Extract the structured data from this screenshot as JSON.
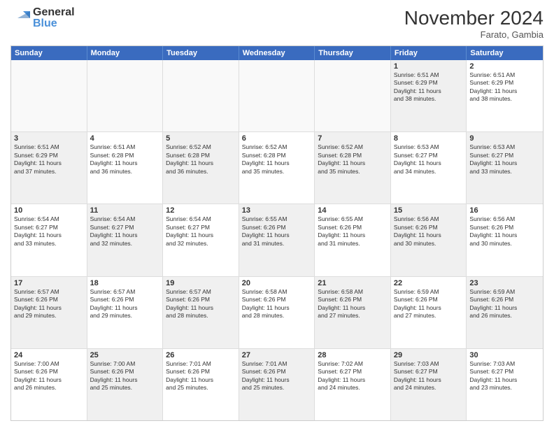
{
  "logo": {
    "general": "General",
    "blue": "Blue"
  },
  "title": "November 2024",
  "location": "Farato, Gambia",
  "days": [
    "Sunday",
    "Monday",
    "Tuesday",
    "Wednesday",
    "Thursday",
    "Friday",
    "Saturday"
  ],
  "rows": [
    [
      {
        "day": "",
        "text": "",
        "empty": true
      },
      {
        "day": "",
        "text": "",
        "empty": true
      },
      {
        "day": "",
        "text": "",
        "empty": true
      },
      {
        "day": "",
        "text": "",
        "empty": true
      },
      {
        "day": "",
        "text": "",
        "empty": true
      },
      {
        "day": "1",
        "text": "Sunrise: 6:51 AM\nSunset: 6:29 PM\nDaylight: 11 hours\nand 38 minutes.",
        "shaded": true
      },
      {
        "day": "2",
        "text": "Sunrise: 6:51 AM\nSunset: 6:29 PM\nDaylight: 11 hours\nand 38 minutes.",
        "shaded": false
      }
    ],
    [
      {
        "day": "3",
        "text": "Sunrise: 6:51 AM\nSunset: 6:29 PM\nDaylight: 11 hours\nand 37 minutes.",
        "shaded": true
      },
      {
        "day": "4",
        "text": "Sunrise: 6:51 AM\nSunset: 6:28 PM\nDaylight: 11 hours\nand 36 minutes.",
        "shaded": false
      },
      {
        "day": "5",
        "text": "Sunrise: 6:52 AM\nSunset: 6:28 PM\nDaylight: 11 hours\nand 36 minutes.",
        "shaded": true
      },
      {
        "day": "6",
        "text": "Sunrise: 6:52 AM\nSunset: 6:28 PM\nDaylight: 11 hours\nand 35 minutes.",
        "shaded": false
      },
      {
        "day": "7",
        "text": "Sunrise: 6:52 AM\nSunset: 6:28 PM\nDaylight: 11 hours\nand 35 minutes.",
        "shaded": true
      },
      {
        "day": "8",
        "text": "Sunrise: 6:53 AM\nSunset: 6:27 PM\nDaylight: 11 hours\nand 34 minutes.",
        "shaded": false
      },
      {
        "day": "9",
        "text": "Sunrise: 6:53 AM\nSunset: 6:27 PM\nDaylight: 11 hours\nand 33 minutes.",
        "shaded": true
      }
    ],
    [
      {
        "day": "10",
        "text": "Sunrise: 6:54 AM\nSunset: 6:27 PM\nDaylight: 11 hours\nand 33 minutes.",
        "shaded": false
      },
      {
        "day": "11",
        "text": "Sunrise: 6:54 AM\nSunset: 6:27 PM\nDaylight: 11 hours\nand 32 minutes.",
        "shaded": true
      },
      {
        "day": "12",
        "text": "Sunrise: 6:54 AM\nSunset: 6:27 PM\nDaylight: 11 hours\nand 32 minutes.",
        "shaded": false
      },
      {
        "day": "13",
        "text": "Sunrise: 6:55 AM\nSunset: 6:26 PM\nDaylight: 11 hours\nand 31 minutes.",
        "shaded": true
      },
      {
        "day": "14",
        "text": "Sunrise: 6:55 AM\nSunset: 6:26 PM\nDaylight: 11 hours\nand 31 minutes.",
        "shaded": false
      },
      {
        "day": "15",
        "text": "Sunrise: 6:56 AM\nSunset: 6:26 PM\nDaylight: 11 hours\nand 30 minutes.",
        "shaded": true
      },
      {
        "day": "16",
        "text": "Sunrise: 6:56 AM\nSunset: 6:26 PM\nDaylight: 11 hours\nand 30 minutes.",
        "shaded": false
      }
    ],
    [
      {
        "day": "17",
        "text": "Sunrise: 6:57 AM\nSunset: 6:26 PM\nDaylight: 11 hours\nand 29 minutes.",
        "shaded": true
      },
      {
        "day": "18",
        "text": "Sunrise: 6:57 AM\nSunset: 6:26 PM\nDaylight: 11 hours\nand 29 minutes.",
        "shaded": false
      },
      {
        "day": "19",
        "text": "Sunrise: 6:57 AM\nSunset: 6:26 PM\nDaylight: 11 hours\nand 28 minutes.",
        "shaded": true
      },
      {
        "day": "20",
        "text": "Sunrise: 6:58 AM\nSunset: 6:26 PM\nDaylight: 11 hours\nand 28 minutes.",
        "shaded": false
      },
      {
        "day": "21",
        "text": "Sunrise: 6:58 AM\nSunset: 6:26 PM\nDaylight: 11 hours\nand 27 minutes.",
        "shaded": true
      },
      {
        "day": "22",
        "text": "Sunrise: 6:59 AM\nSunset: 6:26 PM\nDaylight: 11 hours\nand 27 minutes.",
        "shaded": false
      },
      {
        "day": "23",
        "text": "Sunrise: 6:59 AM\nSunset: 6:26 PM\nDaylight: 11 hours\nand 26 minutes.",
        "shaded": true
      }
    ],
    [
      {
        "day": "24",
        "text": "Sunrise: 7:00 AM\nSunset: 6:26 PM\nDaylight: 11 hours\nand 26 minutes.",
        "shaded": false
      },
      {
        "day": "25",
        "text": "Sunrise: 7:00 AM\nSunset: 6:26 PM\nDaylight: 11 hours\nand 25 minutes.",
        "shaded": true
      },
      {
        "day": "26",
        "text": "Sunrise: 7:01 AM\nSunset: 6:26 PM\nDaylight: 11 hours\nand 25 minutes.",
        "shaded": false
      },
      {
        "day": "27",
        "text": "Sunrise: 7:01 AM\nSunset: 6:26 PM\nDaylight: 11 hours\nand 25 minutes.",
        "shaded": true
      },
      {
        "day": "28",
        "text": "Sunrise: 7:02 AM\nSunset: 6:27 PM\nDaylight: 11 hours\nand 24 minutes.",
        "shaded": false
      },
      {
        "day": "29",
        "text": "Sunrise: 7:03 AM\nSunset: 6:27 PM\nDaylight: 11 hours\nand 24 minutes.",
        "shaded": true
      },
      {
        "day": "30",
        "text": "Sunrise: 7:03 AM\nSunset: 6:27 PM\nDaylight: 11 hours\nand 23 minutes.",
        "shaded": false
      }
    ]
  ]
}
